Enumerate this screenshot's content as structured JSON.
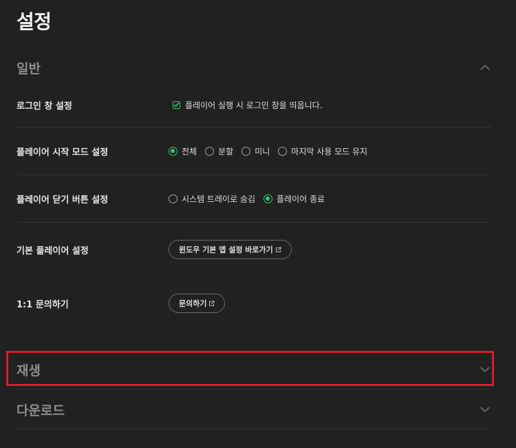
{
  "page": {
    "title": "설정"
  },
  "sections": {
    "general": {
      "label": "일반",
      "expanded": true
    },
    "playback": {
      "label": "재생",
      "expanded": false
    },
    "download": {
      "label": "다운로드",
      "expanded": false
    }
  },
  "general": {
    "login_window": {
      "label": "로그인 창 설정",
      "checkbox_label": "플레이어 실행 시 로그인 창을 띄웁니다.",
      "checked": true
    },
    "start_mode": {
      "label": "플레이어 시작 모드 설정",
      "options": [
        "전체",
        "분할",
        "미니",
        "마지막 사용 모드 유지"
      ],
      "selected": "전체"
    },
    "close_button": {
      "label": "플레이어 닫기 버튼 설정",
      "options": [
        "시스템 트레이로 숨김",
        "플레이어 종료"
      ],
      "selected": "플레이어 종료"
    },
    "default_player": {
      "label": "기본 플레이어 설정",
      "button_label": "윈도우 기본 앱 설정 바로가기"
    },
    "inquiry": {
      "label": "1:1 문의하기",
      "button_label": "문의하기"
    }
  },
  "colors": {
    "background": "#212121",
    "accent": "#2ecc71",
    "highlight": "#d81e2b"
  }
}
